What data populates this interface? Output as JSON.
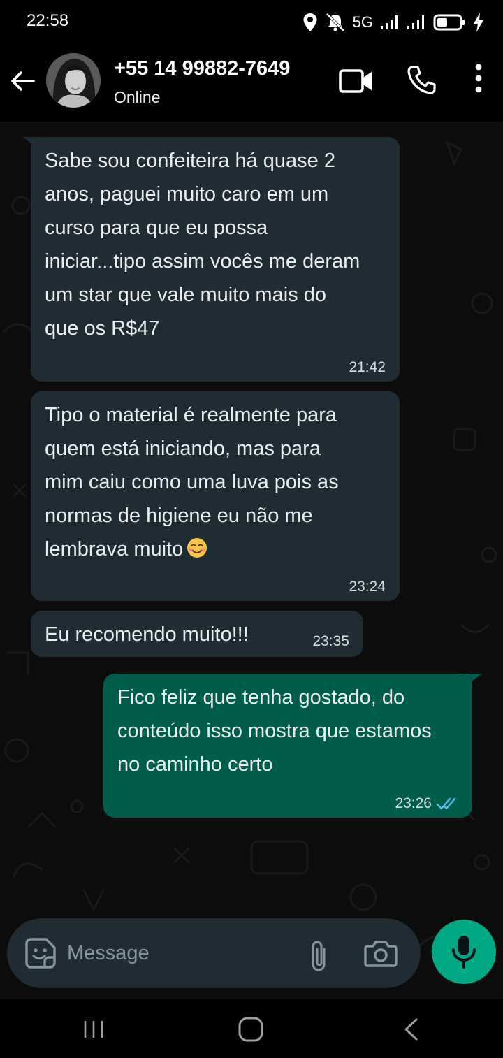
{
  "status_bar": {
    "time": "22:58",
    "network": "5G",
    "icons": [
      "location-icon",
      "notifications-muted-icon",
      "signal-icon",
      "signal-icon",
      "battery-icon",
      "charging-icon"
    ]
  },
  "header": {
    "contact_name": "+55 14 99882-7649",
    "contact_status": "Online",
    "icons": [
      "back-arrow-icon",
      "video-call-icon",
      "phone-call-icon",
      "more-options-icon"
    ]
  },
  "messages": [
    {
      "direction": "incoming",
      "text": "Sabe sou confeiteira há quase 2\nanos, paguei muito caro em um\ncurso para que eu possa\niniciar...tipo assim vocês me deram\num star que vale muito mais do\nque os R$47",
      "time": "21:42"
    },
    {
      "direction": "incoming",
      "text": "Tipo o material é realmente para\nquem está iniciando, mas para\nmim caiu como uma luva pois as\nnormas de higiene eu não me\nlembrava muito",
      "emoji": "smiling-face-emoji",
      "time": "23:24"
    },
    {
      "direction": "incoming",
      "text": "Eu recomendo muito!!!",
      "time": "23:35"
    },
    {
      "direction": "outgoing",
      "text": "Fico feliz que tenha gostado, do\nconteúdo isso mostra que estamos\nno caminho certo",
      "time": "23:26",
      "status": "read"
    }
  ],
  "composer": {
    "placeholder": "Message"
  },
  "colors": {
    "incoming_bubble": "#1f2c34",
    "outgoing_bubble": "#005c4b",
    "accent": "#00a884",
    "read_ticks": "#53bdeb"
  }
}
